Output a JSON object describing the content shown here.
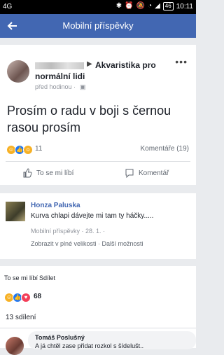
{
  "statusbar": {
    "left": "4G",
    "battery": "46",
    "time": "10:11"
  },
  "appbar": {
    "title": "Mobilní příspěvky"
  },
  "post": {
    "arrow": "▶",
    "group": "Akvaristika pro",
    "group2": "normální lidi",
    "time": "před hodinou ·",
    "text": "Prosím o radu v boji s černou rasou prosím",
    "reaction_count": "11",
    "comments": "Komentáře (19)",
    "like_label": "To se mi líbí",
    "comment_label": "Komentář"
  },
  "comment": {
    "name": "Honza Paluska",
    "text": "Kurva chlapi dávejte mi tam ty háčky.....",
    "meta": "Mobilní příspěvky · 28. 1. ·",
    "links": "Zobrazit v plné velikosti · Další možnosti"
  },
  "actions": {
    "like": "To se mi líbí",
    "share": "Sdílet",
    "reaction_count": "68"
  },
  "shares": "13 sdílení",
  "bottom_comment": {
    "name": "Tomáš Poslušný",
    "text": "A já chtěl zase přidat rozkol s šídelušt.."
  }
}
